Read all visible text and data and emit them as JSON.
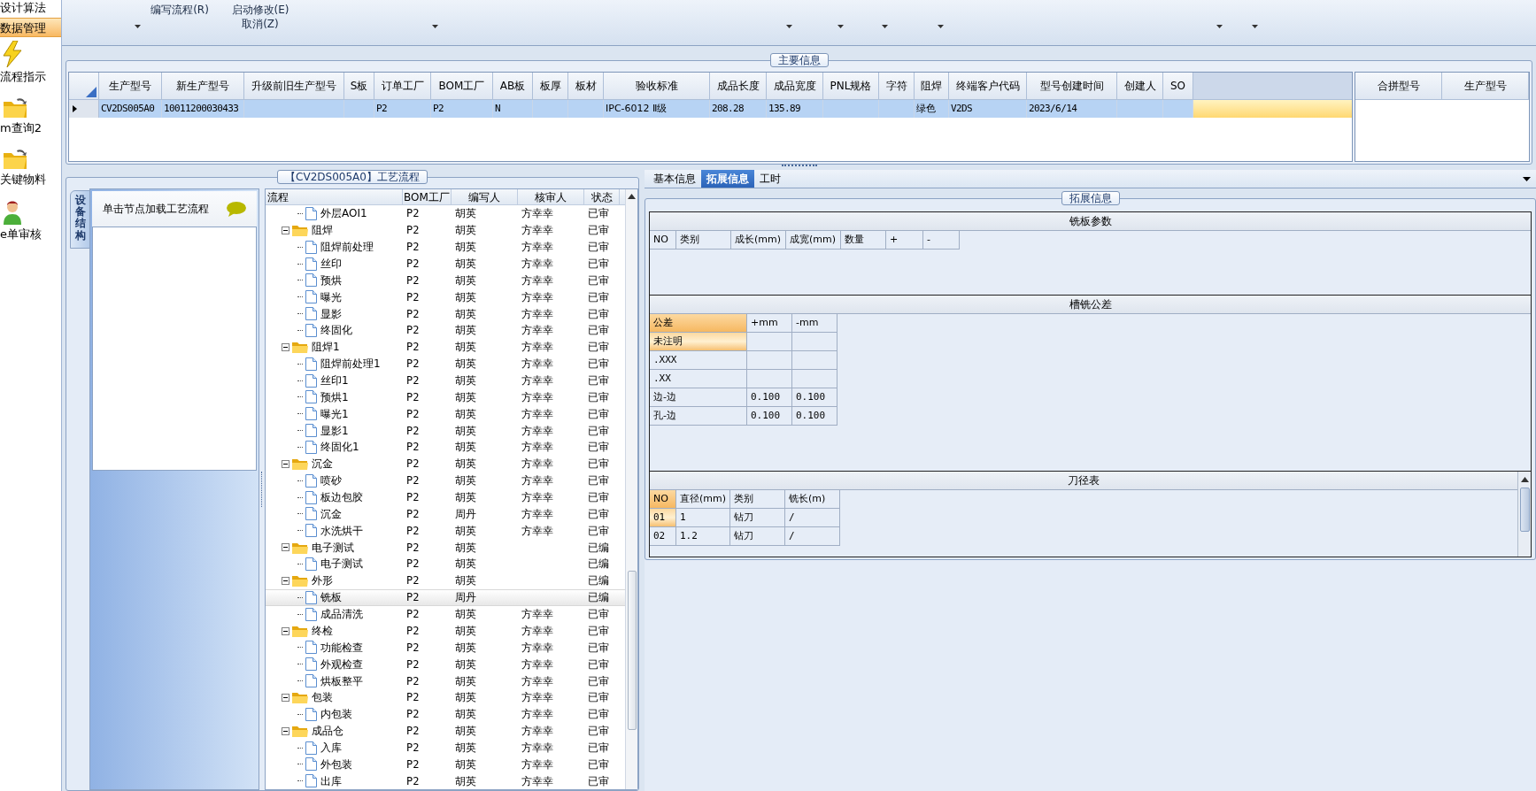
{
  "sidebar": {
    "items": [
      {
        "label": "设计算法",
        "kind": "text",
        "selected": false
      },
      {
        "label": "数据管理",
        "kind": "text",
        "selected": true
      },
      {
        "label": "流程指示",
        "kind": "bolt",
        "selected": false
      },
      {
        "label": "m查询2",
        "kind": "folder",
        "selected": false
      },
      {
        "label": "关键物料",
        "kind": "folder",
        "selected": false
      },
      {
        "label": "e单审核",
        "kind": "person",
        "selected": false
      }
    ]
  },
  "toolbar": {
    "items": [
      {
        "kind": "dropdown"
      },
      {
        "kind": "text",
        "labels": [
          "编写流程(R)"
        ]
      },
      {
        "kind": "text",
        "labels": [
          "启动修改(E)",
          "取消(Z)"
        ]
      },
      {
        "kind": "dropdown"
      },
      {
        "kind": "dropdown"
      },
      {
        "kind": "dropdown"
      },
      {
        "kind": "dropdown"
      },
      {
        "kind": "dropdown"
      },
      {
        "kind": "dropdown"
      },
      {
        "kind": "dropdown"
      }
    ]
  },
  "main_info": {
    "title": "主要信息",
    "columns": [
      "生产型号",
      "新生产型号",
      "升级前旧生产型号",
      "S板",
      "订单工厂",
      "BOM工厂",
      "AB板",
      "板厚",
      "板材",
      "验收标准",
      "成品长度",
      "成品宽度",
      "PNL规格",
      "字符",
      "阻焊",
      "终端客户代码",
      "型号创建时间",
      "创建人",
      "SO"
    ],
    "rows": [
      {
        "selected": true,
        "cells": [
          "CV2DS005A0",
          "10011200030433",
          null,
          null,
          "P2",
          "P2",
          "N",
          null,
          null,
          "IPC-6012 Ⅱ级",
          "208.28",
          "135.89",
          null,
          null,
          "绿色",
          "V2DS",
          "2023/6/14",
          null,
          null
        ]
      }
    ],
    "side_columns": [
      "合拼型号",
      "生产型号"
    ]
  },
  "process_flow": {
    "title": "【CV2DS005A0】工艺流程",
    "vertical_tab": "设备结构",
    "hint": "单击节点加载工艺流程",
    "columns": [
      "流程",
      "BOM工厂",
      "编写人",
      "核审人",
      "状态"
    ],
    "nodes": [
      {
        "kind": "file",
        "name": "外层AOI1",
        "factory": "P2",
        "writer": "胡英",
        "reviewer": "方幸幸",
        "status": "已审",
        "selected": false
      },
      {
        "kind": "folder",
        "name": "阻焊",
        "factory": "P2",
        "writer": "胡英",
        "reviewer": "方幸幸",
        "status": "已审",
        "selected": false,
        "expanded": true,
        "children": [
          {
            "kind": "file",
            "name": "阻焊前处理",
            "factory": "P2",
            "writer": "胡英",
            "reviewer": "方幸幸",
            "status": "已审",
            "selected": false
          },
          {
            "kind": "file",
            "name": "丝印",
            "factory": "P2",
            "writer": "胡英",
            "reviewer": "方幸幸",
            "status": "已审",
            "selected": false
          },
          {
            "kind": "file",
            "name": "预烘",
            "factory": "P2",
            "writer": "胡英",
            "reviewer": "方幸幸",
            "status": "已审",
            "selected": false
          },
          {
            "kind": "file",
            "name": "曝光",
            "factory": "P2",
            "writer": "胡英",
            "reviewer": "方幸幸",
            "status": "已审",
            "selected": false
          },
          {
            "kind": "file",
            "name": "显影",
            "factory": "P2",
            "writer": "胡英",
            "reviewer": "方幸幸",
            "status": "已审",
            "selected": false
          },
          {
            "kind": "file",
            "name": "终固化",
            "factory": "P2",
            "writer": "胡英",
            "reviewer": "方幸幸",
            "status": "已审",
            "selected": false
          }
        ]
      },
      {
        "kind": "folder",
        "name": "阻焊1",
        "factory": "P2",
        "writer": "胡英",
        "reviewer": "方幸幸",
        "status": "已审",
        "selected": false,
        "expanded": true,
        "children": [
          {
            "kind": "file",
            "name": "阻焊前处理1",
            "factory": "P2",
            "writer": "胡英",
            "reviewer": "方幸幸",
            "status": "已审",
            "selected": false
          },
          {
            "kind": "file",
            "name": "丝印1",
            "factory": "P2",
            "writer": "胡英",
            "reviewer": "方幸幸",
            "status": "已审",
            "selected": false
          },
          {
            "kind": "file",
            "name": "预烘1",
            "factory": "P2",
            "writer": "胡英",
            "reviewer": "方幸幸",
            "status": "已审",
            "selected": false
          },
          {
            "kind": "file",
            "name": "曝光1",
            "factory": "P2",
            "writer": "胡英",
            "reviewer": "方幸幸",
            "status": "已审",
            "selected": false
          },
          {
            "kind": "file",
            "name": "显影1",
            "factory": "P2",
            "writer": "胡英",
            "reviewer": "方幸幸",
            "status": "已审",
            "selected": false
          },
          {
            "kind": "file",
            "name": "终固化1",
            "factory": "P2",
            "writer": "胡英",
            "reviewer": "方幸幸",
            "status": "已审",
            "selected": false
          }
        ]
      },
      {
        "kind": "folder",
        "name": "沉金",
        "factory": "P2",
        "writer": "胡英",
        "reviewer": "方幸幸",
        "status": "已审",
        "selected": false,
        "expanded": true,
        "children": [
          {
            "kind": "file",
            "name": "喷砂",
            "factory": "P2",
            "writer": "胡英",
            "reviewer": "方幸幸",
            "status": "已审",
            "selected": false
          },
          {
            "kind": "file",
            "name": "板边包胶",
            "factory": "P2",
            "writer": "胡英",
            "reviewer": "方幸幸",
            "status": "已审",
            "selected": false
          },
          {
            "kind": "file",
            "name": "沉金",
            "factory": "P2",
            "writer": "周丹",
            "reviewer": "方幸幸",
            "status": "已审",
            "selected": false
          },
          {
            "kind": "file",
            "name": "水洗烘干",
            "factory": "P2",
            "writer": "胡英",
            "reviewer": "方幸幸",
            "status": "已审",
            "selected": false
          }
        ]
      },
      {
        "kind": "folder",
        "name": "电子测试",
        "factory": "P2",
        "writer": "胡英",
        "status": "已编",
        "selected": false,
        "expanded": true,
        "children": [
          {
            "kind": "file",
            "name": "电子测试",
            "factory": "P2",
            "writer": "胡英",
            "status": "已编",
            "selected": false
          }
        ]
      },
      {
        "kind": "folder",
        "name": "外形",
        "factory": "P2",
        "writer": "胡英",
        "status": "已编",
        "selected": false,
        "expanded": true,
        "children": [
          {
            "kind": "file",
            "name": "铣板",
            "factory": "P2",
            "writer": "周丹",
            "status": "已编",
            "selected": true
          },
          {
            "kind": "file",
            "name": "成品清洗",
            "factory": "P2",
            "writer": "胡英",
            "reviewer": "方幸幸",
            "status": "已审",
            "selected": false
          }
        ]
      },
      {
        "kind": "folder",
        "name": "终检",
        "factory": "P2",
        "writer": "胡英",
        "reviewer": "方幸幸",
        "status": "已审",
        "selected": false,
        "expanded": true,
        "children": [
          {
            "kind": "file",
            "name": "功能检查",
            "factory": "P2",
            "writer": "胡英",
            "reviewer": "方幸幸",
            "status": "已审",
            "selected": false
          },
          {
            "kind": "file",
            "name": "外观检查",
            "factory": "P2",
            "writer": "胡英",
            "reviewer": "方幸幸",
            "status": "已审",
            "selected": false
          },
          {
            "kind": "file",
            "name": "烘板整平",
            "factory": "P2",
            "writer": "胡英",
            "reviewer": "方幸幸",
            "status": "已审",
            "selected": false
          }
        ]
      },
      {
        "kind": "folder",
        "name": "包装",
        "factory": "P2",
        "writer": "胡英",
        "reviewer": "方幸幸",
        "status": "已审",
        "selected": false,
        "expanded": true,
        "children": [
          {
            "kind": "file",
            "name": "内包装",
            "factory": "P2",
            "writer": "胡英",
            "reviewer": "方幸幸",
            "status": "已审",
            "selected": false
          }
        ]
      },
      {
        "kind": "folder",
        "name": "成品仓",
        "factory": "P2",
        "writer": "胡英",
        "reviewer": "方幸幸",
        "status": "已审",
        "selected": false,
        "expanded": true,
        "children": [
          {
            "kind": "file",
            "name": "入库",
            "factory": "P2",
            "writer": "胡英",
            "reviewer": "方幸幸",
            "status": "已审",
            "selected": false
          },
          {
            "kind": "file",
            "name": "外包装",
            "factory": "P2",
            "writer": "胡英",
            "reviewer": "方幸幸",
            "status": "已审",
            "selected": false
          },
          {
            "kind": "file",
            "name": "出库",
            "factory": "P2",
            "writer": "胡英",
            "reviewer": "方幸幸",
            "status": "已审",
            "selected": false
          }
        ]
      }
    ]
  },
  "detail": {
    "tabs": [
      {
        "label": "基本信息",
        "selected": false
      },
      {
        "label": "拓展信息",
        "selected": true
      },
      {
        "label": "工时",
        "selected": false
      }
    ],
    "group_title": "拓展信息",
    "milling_params": {
      "title": "铣板参数",
      "columns": [
        "NO",
        "类别",
        "成长(mm)",
        "成宽(mm)",
        "数量",
        "+",
        "-"
      ]
    },
    "slot_tolerance": {
      "title": "槽铣公差",
      "columns": [
        "公差",
        "+mm",
        "-mm"
      ],
      "rows": [
        {
          "selected": true,
          "cells": [
            "未注明",
            null,
            null
          ]
        },
        {
          "selected": false,
          "cells": [
            ".XXX",
            null,
            null
          ]
        },
        {
          "selected": false,
          "cells": [
            ".XX",
            null,
            null
          ]
        },
        {
          "selected": false,
          "cells": [
            "边-边",
            "0.100",
            "0.100"
          ]
        },
        {
          "selected": false,
          "cells": [
            "孔-边",
            "0.100",
            "0.100"
          ]
        }
      ]
    },
    "tool_diameters": {
      "title": "刀径表",
      "columns": [
        "NO",
        "直径(mm)",
        "类别",
        "铣长(m)"
      ],
      "rows": [
        {
          "selected": true,
          "cells": [
            "01",
            "1",
            "钻刀",
            "/"
          ]
        },
        {
          "selected": false,
          "cells": [
            "02",
            "1.2",
            "钻刀",
            "/"
          ]
        }
      ]
    }
  }
}
